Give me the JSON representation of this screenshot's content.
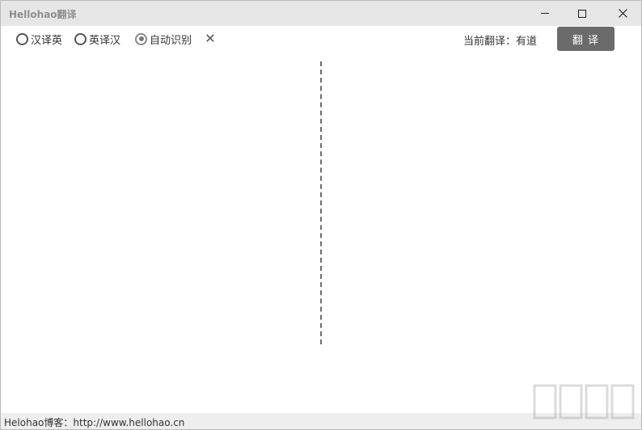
{
  "titlebar": {
    "title": "Hellohao翻译"
  },
  "toolbar": {
    "options": [
      {
        "label": "汉译英",
        "checked": false
      },
      {
        "label": "英译汉",
        "checked": false
      },
      {
        "label": "自动识别",
        "checked": true
      }
    ],
    "clear_icon": "close-icon",
    "engine_text": "当前翻译：有道",
    "translate_label": "翻 译"
  },
  "main": {
    "source_text": "",
    "result_text": ""
  },
  "status": {
    "blog_text": "Helohao博客：http://www.hellohao.cn"
  },
  "colors": {
    "titlebar_bg": "#e6e6e6",
    "button_bg": "#6b6b6b",
    "status_bg": "#eeeeee"
  }
}
